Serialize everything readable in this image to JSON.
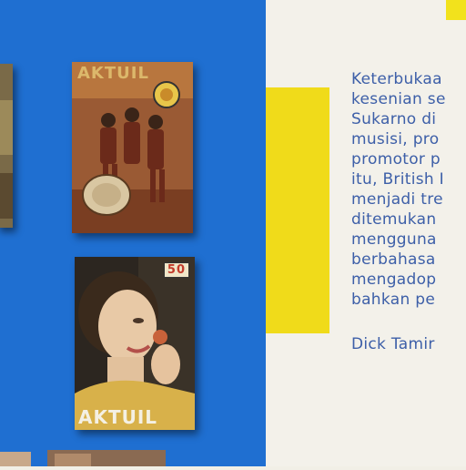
{
  "colors": {
    "wall": "#1f6fd1",
    "panel": "#f3f1ea",
    "accent_yellow": "#f0db1a",
    "text": "#3d5fa8"
  },
  "magazines": [
    {
      "masthead": "AKTUIL",
      "description": "vintage magazine cover with band photo"
    },
    {
      "masthead": "AKTUIL",
      "badge": "50",
      "description": "vintage magazine cover with woman portrait"
    }
  ],
  "panel_text": {
    "lines": [
      "Keterbukaa",
      "kesenian se",
      "Sukarno di",
      "musisi, pro",
      "promotor p",
      "itu, British I",
      "menjadi tre",
      "ditemukan",
      "mengguna",
      "berbahasa",
      "mengadop",
      "bahkan pe"
    ],
    "next_paragraph": "Dick Tamir"
  }
}
